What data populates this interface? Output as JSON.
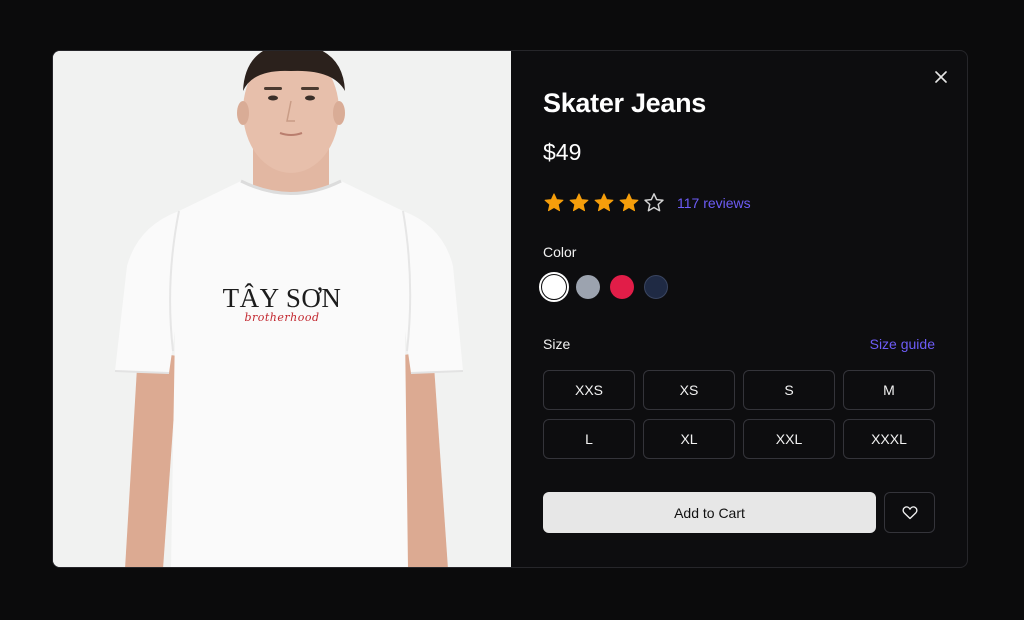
{
  "product": {
    "image_alt": "Model wearing white t-shirt",
    "print_main": "TÂY SƠN",
    "print_script": "brotherhood",
    "title": "Skater Jeans",
    "price": "$49",
    "rating": 4,
    "rating_max": 5,
    "reviews": "117 reviews"
  },
  "color": {
    "label": "Color",
    "options": [
      {
        "name": "white",
        "hex": "#ffffff",
        "selected": true
      },
      {
        "name": "gray",
        "hex": "#9ca3af",
        "selected": false
      },
      {
        "name": "red",
        "hex": "#e11d48",
        "selected": false
      },
      {
        "name": "navy",
        "hex": "#1f2a44",
        "selected": false
      }
    ]
  },
  "size": {
    "label": "Size",
    "guide_label": "Size guide",
    "options": [
      "XXS",
      "XS",
      "S",
      "M",
      "L",
      "XL",
      "XXL",
      "XXXL"
    ]
  },
  "actions": {
    "add_to_cart": "Add to Cart"
  },
  "colors": {
    "accent": "#6d5cf6",
    "star": "#f59e0b"
  }
}
